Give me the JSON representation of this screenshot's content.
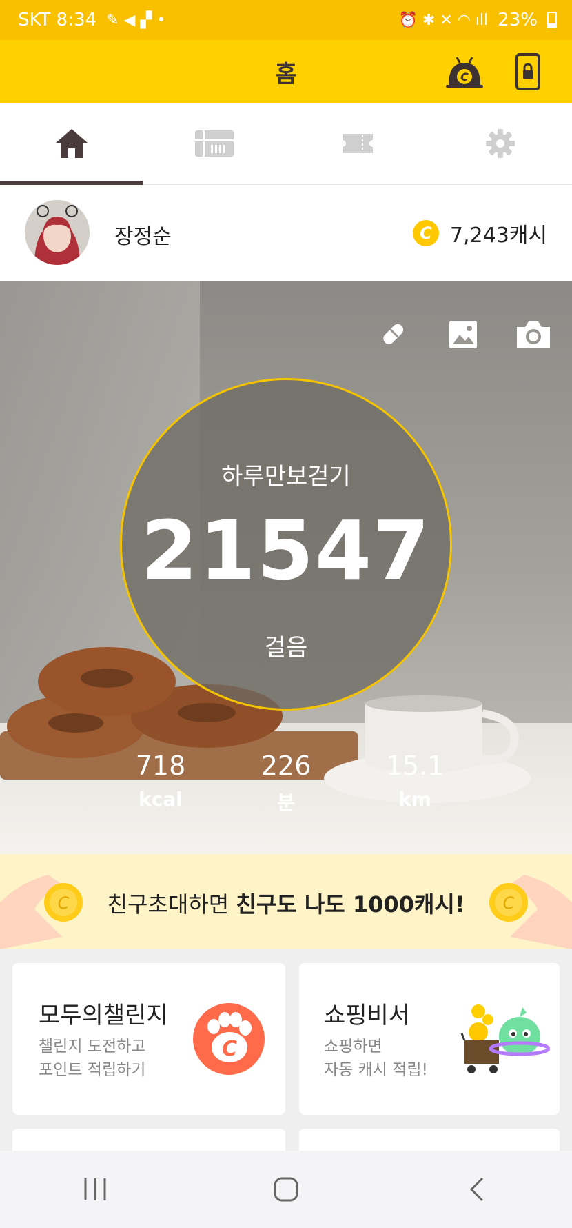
{
  "status_bar": {
    "carrier_time": "SKT 8:34",
    "battery": "23%"
  },
  "header": {
    "title": "홈"
  },
  "tabs": [
    {
      "icon": "home-icon",
      "active": true
    },
    {
      "icon": "gift-card-icon",
      "active": false
    },
    {
      "icon": "ticket-icon",
      "active": false
    },
    {
      "icon": "gear-icon",
      "active": false
    }
  ],
  "profile": {
    "name": "장정순",
    "cash": "7,243캐시",
    "coin_symbol": "C"
  },
  "steps": {
    "label": "하루만보걷기",
    "count": "21547",
    "unit": "걸음"
  },
  "stats": [
    {
      "value": "718",
      "unit": "kcal"
    },
    {
      "value": "226",
      "unit": "분"
    },
    {
      "value": "15.1",
      "unit": "km"
    }
  ],
  "banner": {
    "text_normal": "친구초대하면 ",
    "text_bold": "친구도 나도 1000캐시!"
  },
  "cards": [
    {
      "title": "모두의챌린지",
      "sub1": "챌린지 도전하고",
      "sub2": "포인트 적립하기"
    },
    {
      "title": "쇼핑비서",
      "sub1": "쇼핑하면",
      "sub2": "자동 캐시 적립!"
    }
  ],
  "colors": {
    "accent": "#ffd000",
    "status": "#f9c000",
    "ring": "#f5c400",
    "challenge": "#ff6a4a"
  }
}
